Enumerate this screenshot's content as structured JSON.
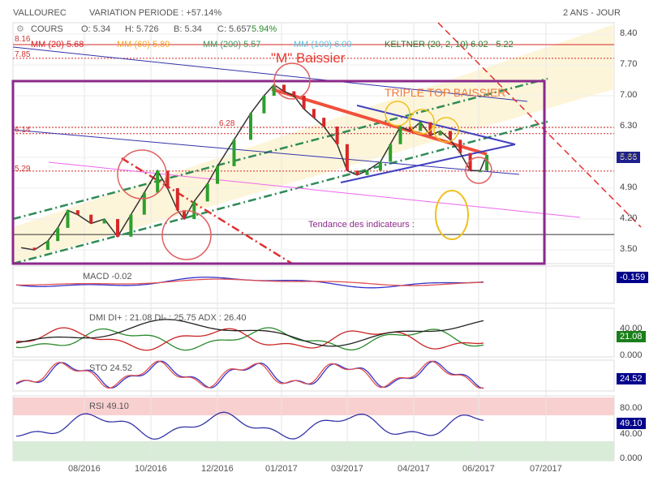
{
  "header": {
    "symbol": "VALLOUREC",
    "variation": "VARIATION PERIODE : +57.14%",
    "period": "2 ANS - JOUR"
  },
  "cours": {
    "label": "COURS",
    "open": "O: 5.34",
    "high": "H: 5.726",
    "low": "B: 5.34",
    "close": "C: 5.657",
    "change": "5.94%"
  },
  "indicators": {
    "mm20": "MM (20) 5.68",
    "mm60": "MM (60) 5.89",
    "mm200": "MM (200) 5.57",
    "mm100": "MM (100) 6.00",
    "keltner": "KELTNER (20, 2, 10) 6.02 - 5.22"
  },
  "annotations": {
    "m": "\"M\" Baissier",
    "triple": "TRIPLE TOP BAISSIER",
    "tendance": "Tendance des indicateurs :",
    "l816": "8.16",
    "l785": "7.85",
    "l628": "6.28",
    "l614": "6.14",
    "l529": "5.29"
  },
  "price_tag": "5.66",
  "panels": {
    "macd": {
      "label": "MACD -0.02",
      "tag": "-0.159"
    },
    "dmi": {
      "label": "DMI DI+ : 21.08 DI- : 25.75 ADX : 26.40",
      "tag": "21.08",
      "ticks": [
        "40.00",
        "0.000"
      ]
    },
    "sto": {
      "label": "STO 24.52",
      "tag": "24.52"
    },
    "rsi": {
      "label": "RSI 49.10",
      "tag": "49.10",
      "ticks": [
        "80.00",
        "40.00",
        "0.000"
      ]
    }
  },
  "chart_data": {
    "type": "line",
    "title": "VALLOUREC",
    "x_ticks": [
      "08/2016",
      "10/2016",
      "12/2016",
      "01/2017",
      "03/2017",
      "04/2017",
      "06/2017",
      "07/2017"
    ],
    "y_ticks": [
      "8.40",
      "7.70",
      "7.00",
      "6.30",
      "5.60",
      "4.90",
      "4.20",
      "3.50"
    ],
    "ylim": [
      3.5,
      8.4
    ],
    "x_unit": "months since 06/2016",
    "price": [
      [
        0.1,
        3.55
      ],
      [
        0.5,
        3.5
      ],
      [
        0.9,
        3.7
      ],
      [
        1.2,
        4.0
      ],
      [
        1.5,
        4.4
      ],
      [
        1.8,
        4.3
      ],
      [
        2.2,
        4.1
      ],
      [
        2.6,
        4.2
      ],
      [
        3.0,
        3.8
      ],
      [
        3.4,
        4.3
      ],
      [
        3.8,
        4.8
      ],
      [
        4.2,
        5.3
      ],
      [
        4.5,
        4.9
      ],
      [
        4.8,
        4.4
      ],
      [
        5.0,
        4.2
      ],
      [
        5.3,
        4.6
      ],
      [
        5.7,
        5.0
      ],
      [
        6.0,
        5.4
      ],
      [
        6.5,
        6.0
      ],
      [
        7.0,
        6.6
      ],
      [
        7.4,
        7.0
      ],
      [
        7.7,
        7.25
      ],
      [
        8.0,
        7.1
      ],
      [
        8.3,
        7.0
      ],
      [
        8.6,
        6.7
      ],
      [
        8.9,
        6.5
      ],
      [
        9.2,
        6.3
      ],
      [
        9.6,
        5.9
      ],
      [
        9.9,
        5.3
      ],
      [
        10.2,
        5.2
      ],
      [
        10.5,
        5.3
      ],
      [
        10.9,
        5.5
      ],
      [
        11.2,
        5.9
      ],
      [
        11.5,
        6.3
      ],
      [
        11.8,
        6.2
      ],
      [
        12.1,
        6.4
      ],
      [
        12.4,
        6.1
      ],
      [
        12.7,
        6.2
      ],
      [
        13.0,
        6.0
      ],
      [
        13.3,
        5.7
      ],
      [
        13.6,
        5.3
      ],
      [
        13.9,
        5.3
      ],
      [
        14.1,
        5.66
      ]
    ],
    "levels": [
      8.16,
      7.85,
      6.28,
      6.14,
      5.29,
      3.85
    ]
  },
  "colors": {
    "up": "#2ca02c",
    "down": "#d62728",
    "keltner": "#fdf3d0",
    "frame": "#8b2a8b"
  }
}
